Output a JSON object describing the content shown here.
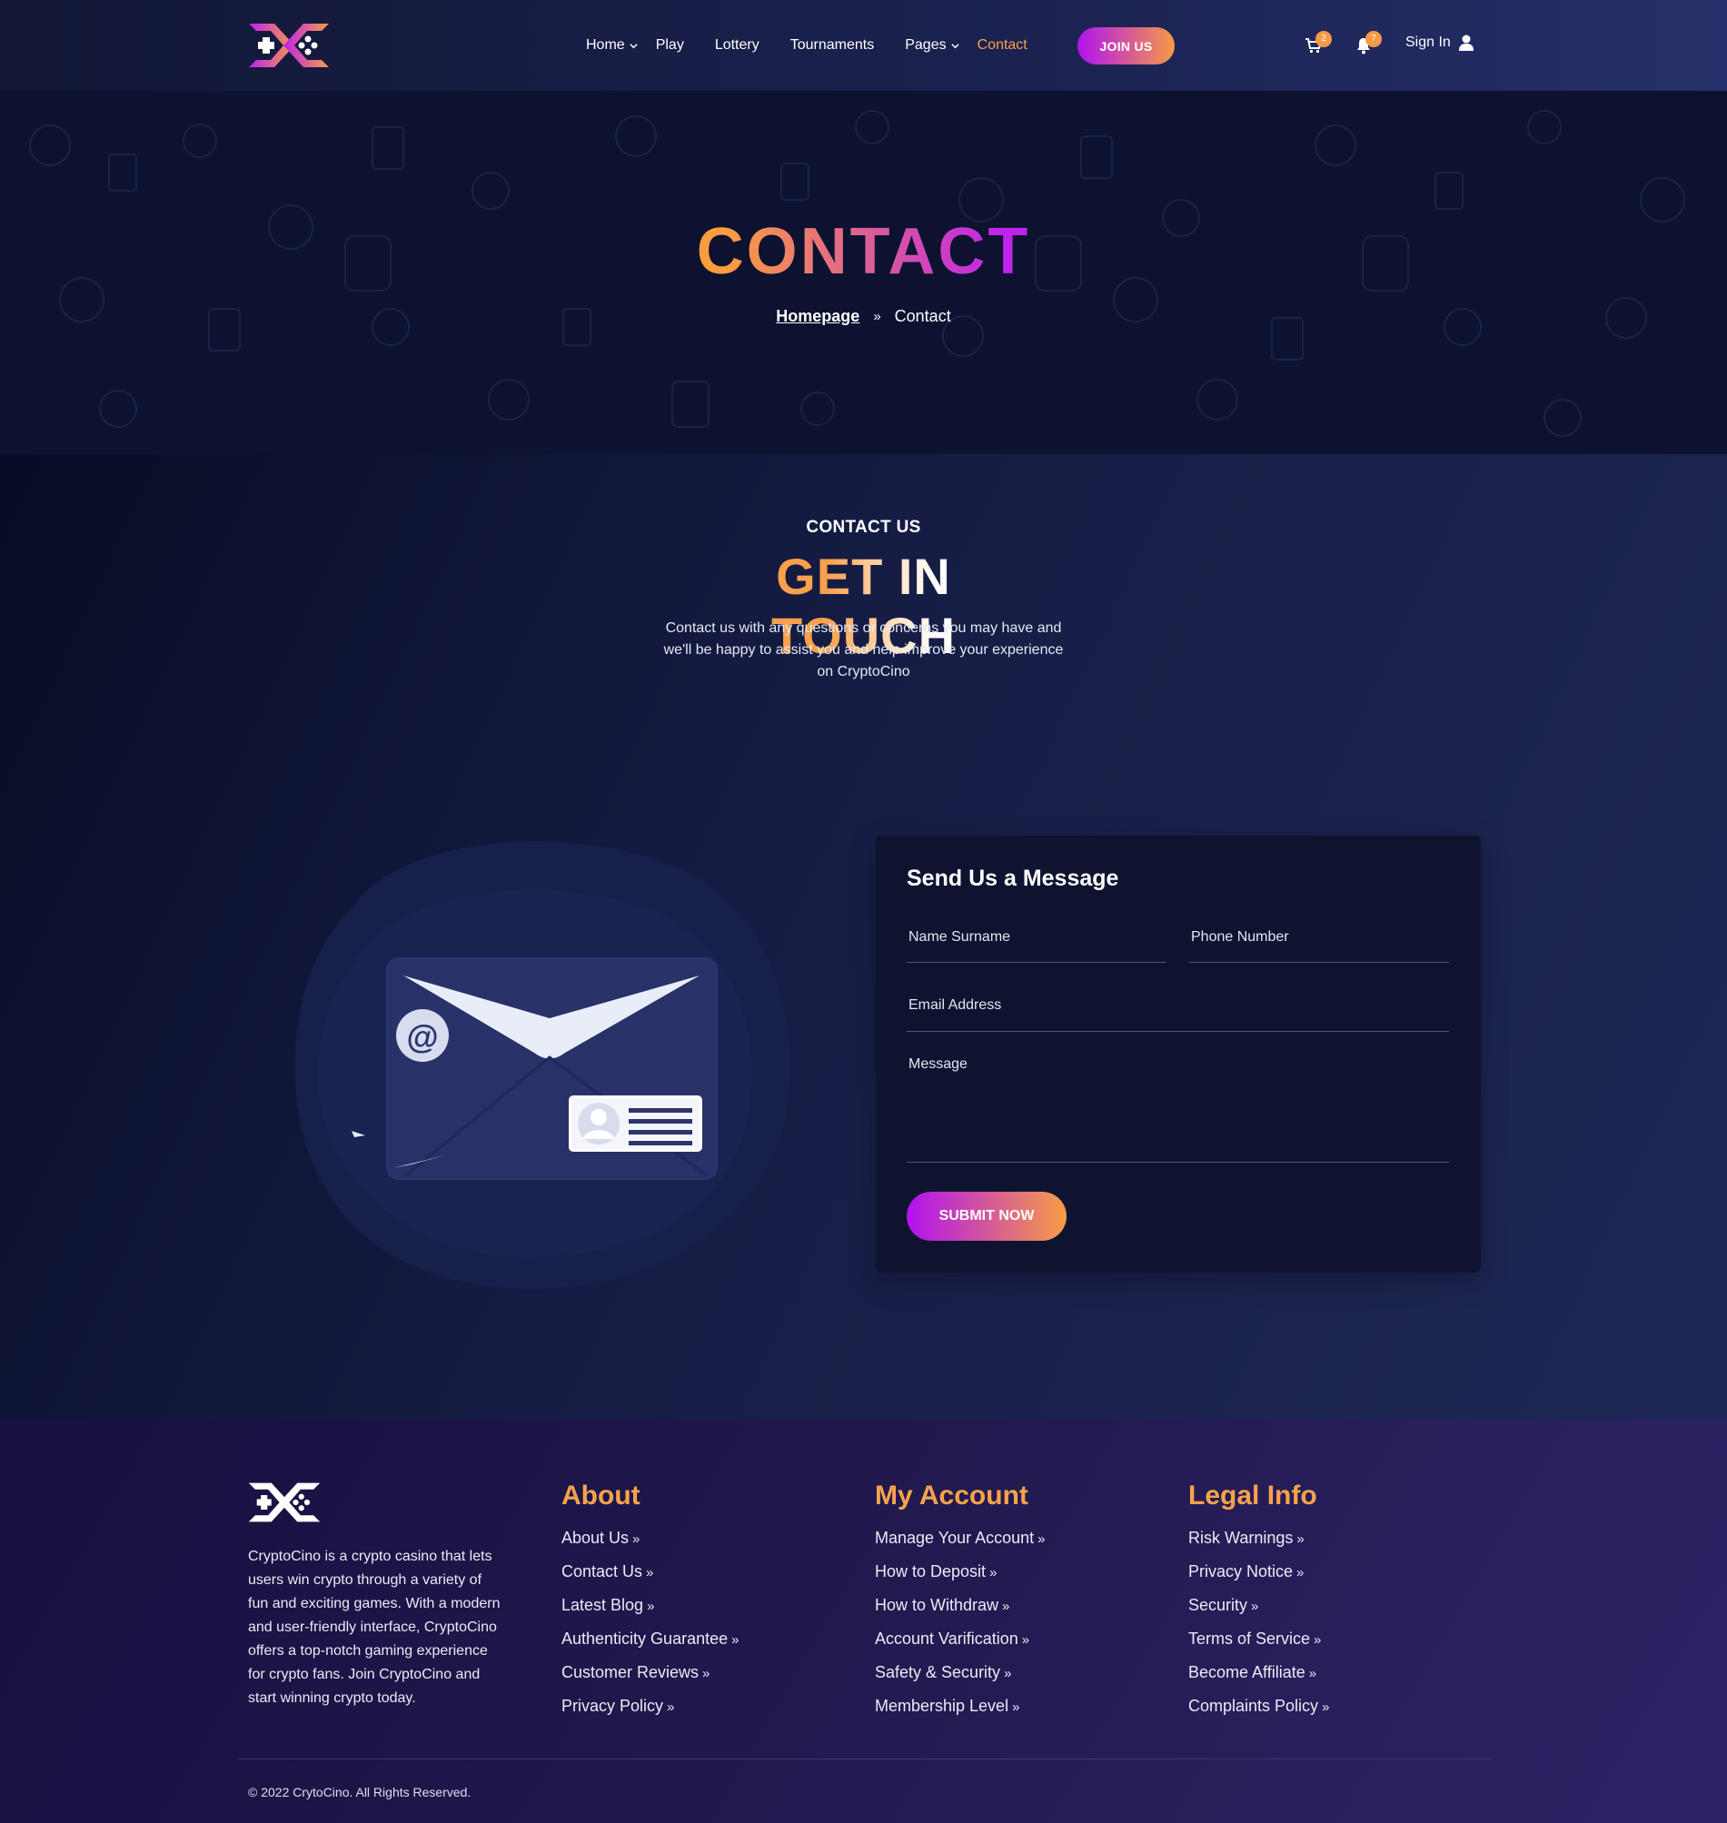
{
  "header": {
    "nav": [
      {
        "label": "Home",
        "dropdown": true,
        "active": false
      },
      {
        "label": "Play",
        "dropdown": false,
        "active": false
      },
      {
        "label": "Lottery",
        "dropdown": false,
        "active": false
      },
      {
        "label": "Tournaments",
        "dropdown": false,
        "active": false
      },
      {
        "label": "Pages",
        "dropdown": true,
        "active": false
      },
      {
        "label": "Contact",
        "dropdown": false,
        "active": true
      }
    ],
    "join_label": "JOIN US",
    "cart_count": "2",
    "notification_count": "7",
    "signin_label": "Sign In"
  },
  "hero": {
    "title": "CONTACT",
    "breadcrumb_home": "Homepage",
    "breadcrumb_current": "Contact"
  },
  "contact": {
    "eyebrow": "CONTACT US",
    "title": "GET IN TOUCH",
    "intro": "Contact us with any questions or concerns you may have and we'll be happy to assist you and help improve your experience on CryptoCino"
  },
  "form": {
    "title": "Send Us a Message",
    "name_placeholder": "Name Surname",
    "phone_placeholder": "Phone Number",
    "email_placeholder": "Email Address",
    "message_placeholder": "Message",
    "submit_label": "SUBMIT NOW"
  },
  "footer": {
    "about_text": "CryptoCino is a crypto casino that lets users win crypto through a variety of fun and exciting games. With a modern and user-friendly interface, CryptoCino offers a top-notch gaming experience for crypto fans. Join CryptoCino and start winning crypto today.",
    "columns": [
      {
        "title": "About",
        "links": [
          "About Us",
          "Contact Us",
          "Latest Blog",
          "Authenticity Guarantee",
          "Customer Reviews",
          "Privacy Policy"
        ]
      },
      {
        "title": "My Account",
        "links": [
          "Manage Your Account",
          "How to Deposit",
          "How to Withdraw",
          "Account Varification",
          "Safety & Security",
          "Membership Level"
        ]
      },
      {
        "title": "Legal Info",
        "links": [
          "Risk Warnings",
          "Privacy Notice",
          "Security",
          "Terms of Service",
          "Become Affiliate",
          "Complaints Policy"
        ]
      }
    ],
    "copyright": "© 2022 CrytoCino. All Rights Reserved."
  },
  "colors": {
    "accent_orange": "#f7a34a",
    "accent_purple": "#b013f0",
    "header_bg": "#121735",
    "footer_bg": "#22194f"
  },
  "icons": [
    "logo-icon",
    "chevron-down-icon",
    "cart-icon",
    "bell-icon",
    "user-icon",
    "double-chevron-right-icon",
    "envelope-illustration"
  ]
}
